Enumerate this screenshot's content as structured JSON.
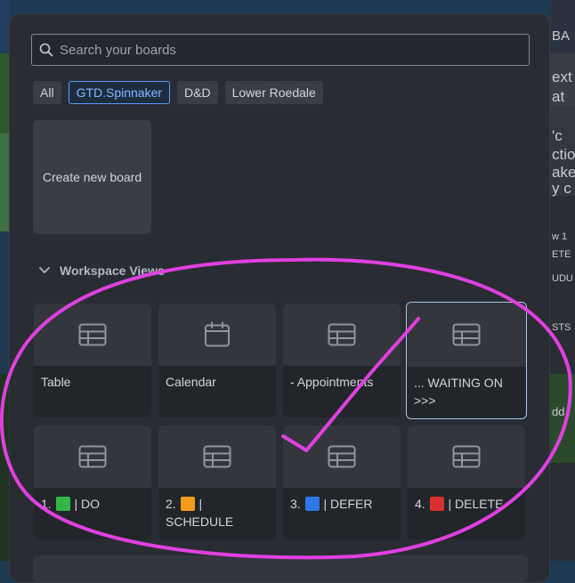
{
  "search": {
    "placeholder": "Search your boards",
    "value": ""
  },
  "filters": [
    {
      "label": "All",
      "active": false
    },
    {
      "label": "GTD.Spinnaker",
      "active": true
    },
    {
      "label": "D&D",
      "active": false
    },
    {
      "label": "Lower Roedale",
      "active": false
    }
  ],
  "create_board": {
    "label": "Create new board"
  },
  "workspace_views": {
    "header": "Workspace Views",
    "items": [
      {
        "label": "Table",
        "icon": "table-icon"
      },
      {
        "label": "Calendar",
        "icon": "calendar-icon"
      },
      {
        "label": "- Appointments",
        "icon": "table-icon"
      },
      {
        "label": "... WAITING ON >>>",
        "icon": "table-icon",
        "selected": true
      },
      {
        "prefix": "1.",
        "emoji_color": "#2fb846",
        "suffix": "| DO",
        "icon": "table-icon"
      },
      {
        "prefix": "2.",
        "emoji_color": "#f59b1c",
        "suffix": "| SCHEDULE",
        "icon": "table-icon"
      },
      {
        "prefix": "3.",
        "emoji_color": "#2f78e6",
        "suffix": "| DEFER",
        "icon": "table-icon"
      },
      {
        "prefix": "4.",
        "emoji_color": "#d8302c",
        "suffix": "| DELETE",
        "icon": "table-icon"
      }
    ]
  },
  "background_fragments": [
    "BA",
    "ext",
    "at",
    "'c",
    "ctio",
    "ake",
    "y c",
    "w 1",
    "ETE",
    "UDU",
    "STS",
    "dd"
  ],
  "colors": {
    "accent": "#579dff",
    "annotation": "#e040e0",
    "panel": "#292c33"
  }
}
